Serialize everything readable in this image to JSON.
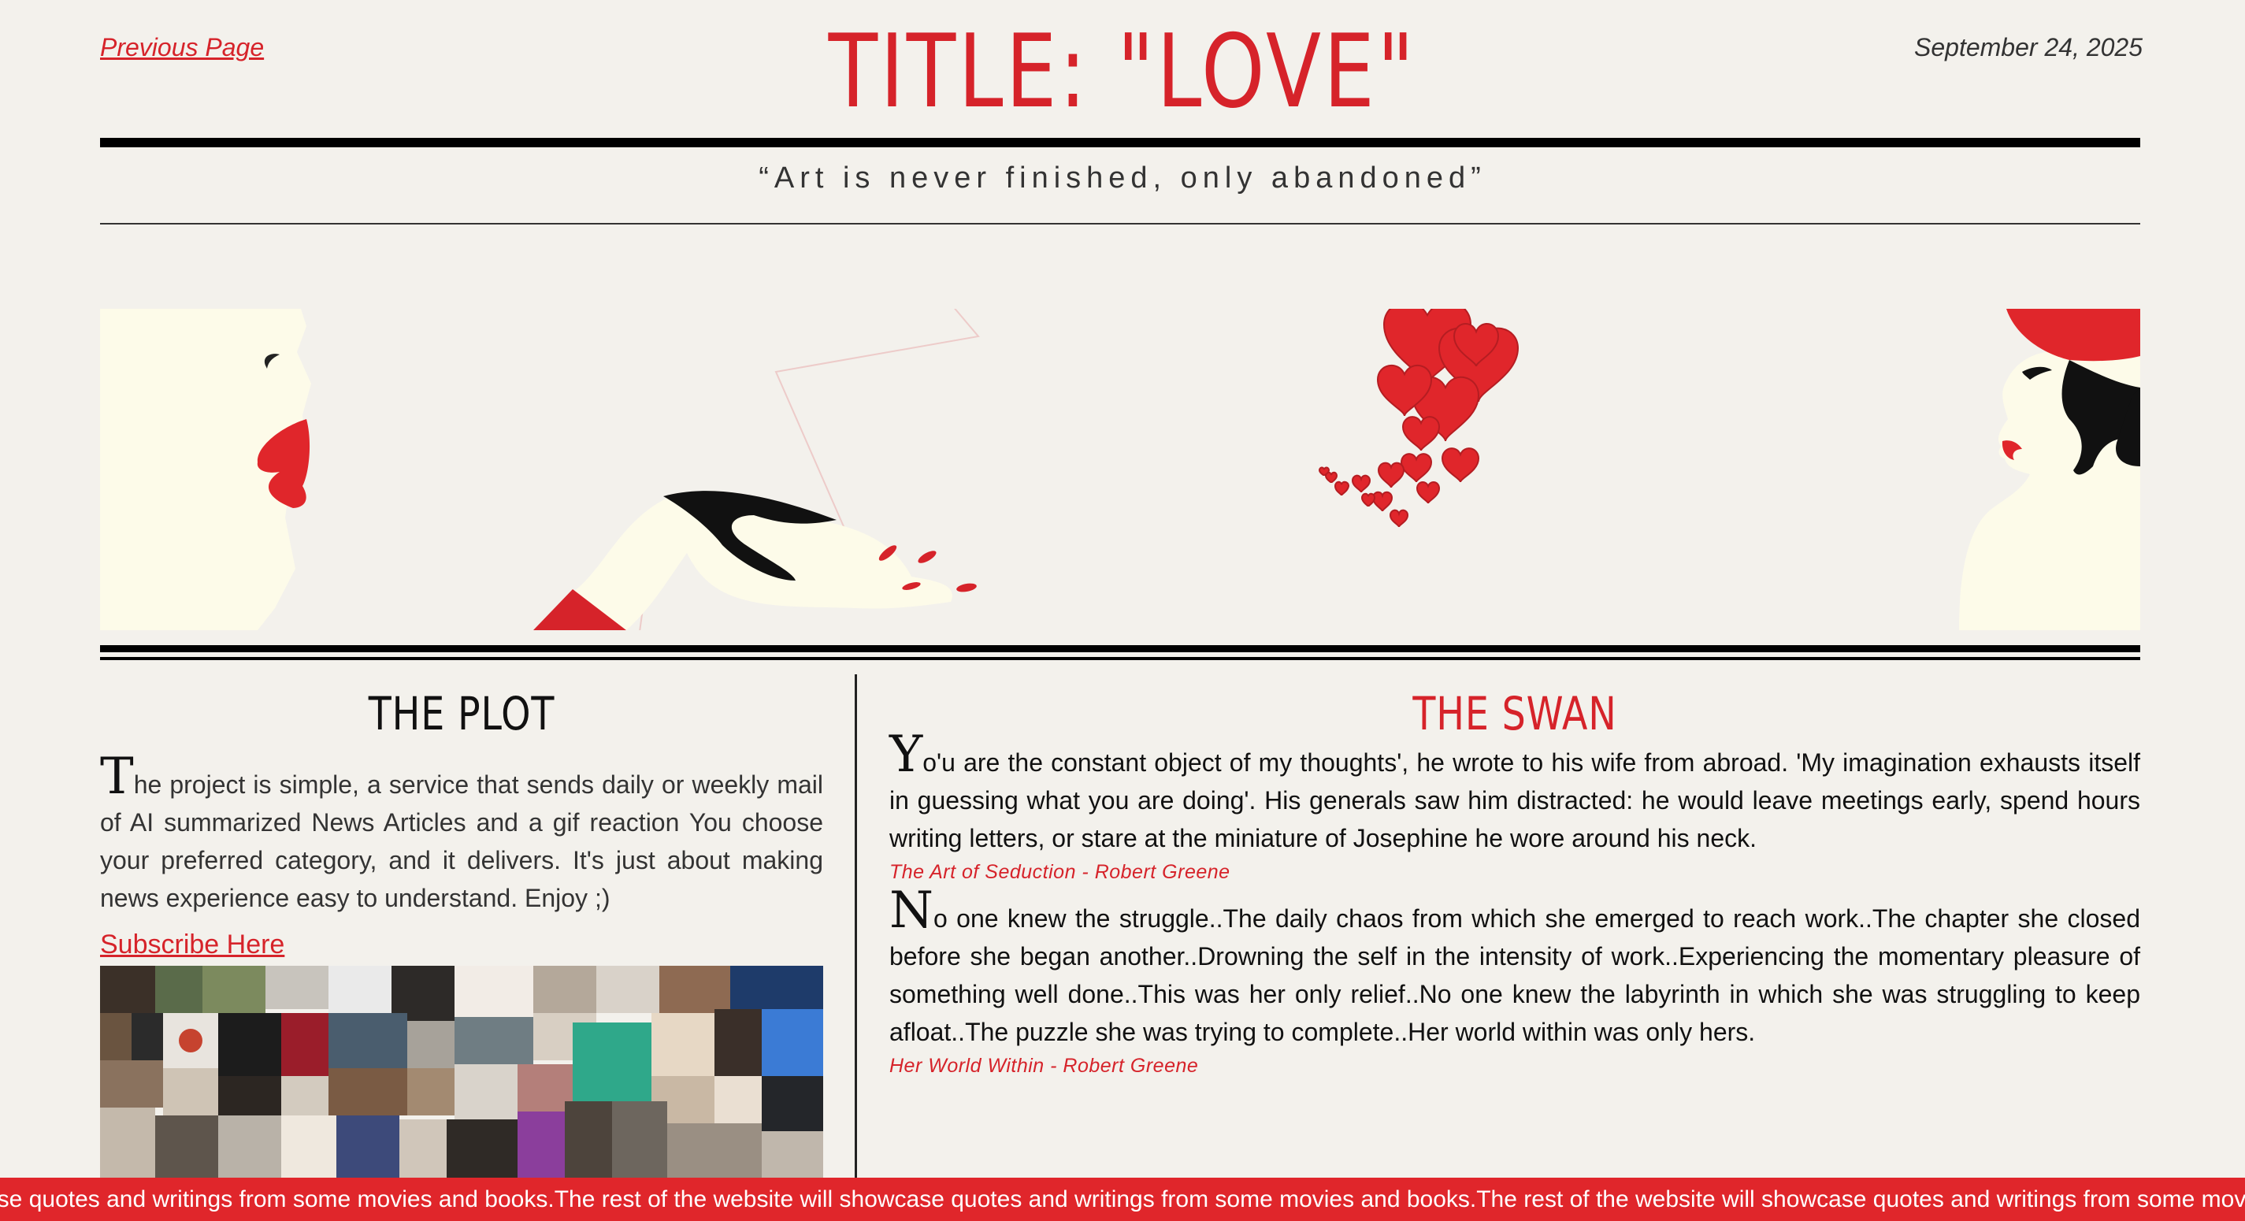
{
  "header": {
    "prev_link": "Previous Page",
    "title": "TITLE: \"LOVE\"",
    "date": "September 24, 2025",
    "quote": "“Art is never finished, only abandoned”"
  },
  "plot": {
    "heading": "THE PLOT",
    "dropcap": "T",
    "text": "he project is simple, a service that sends daily or weekly mail of AI summarized News Articles  and a gif reaction You choose your preferred category, and it delivers. It's just about making news experience easy to understand. Enjoy ;)",
    "subscribe_label": "Subscribe Here"
  },
  "swan": {
    "heading": "THE SWAN",
    "entries": [
      {
        "dropcap": "Y",
        "text": "o'u are the constant object of my thoughts', he wrote to his wife from abroad. 'My imagination exhausts itself in guessing what you are doing'. His generals saw him distracted: he would leave meetings early, spend hours writing letters, or stare at the miniature of Josephine he wore around his neck.",
        "source": "The Art of Seduction - Robert Greene"
      },
      {
        "dropcap": "N",
        "text": "o one knew the struggle..The daily chaos from which she emerged to reach work..The chapter she closed before she began another..Drowning the self in the intensity of work..Experiencing the momentary pleasure of something well done..This was her only relief..No one knew the labyrinth in which she was struggling to keep afloat..The puzzle she was trying to complete..Her world within was only hers.",
        "source": "Her World Within - Robert Greene"
      }
    ]
  },
  "ticker": {
    "text": "ase quotes and writings from some movies and books.The rest of the website will showcase quotes and writings from some movies and books.The rest of the website will showcase quotes and writings from some movies and books.The rest of the website will showcase quotes and writings from some movies and book"
  },
  "colors": {
    "accent": "#d6232a",
    "background": "#f3f1ec",
    "cream": "#fdfbe9",
    "ink": "#000000"
  }
}
